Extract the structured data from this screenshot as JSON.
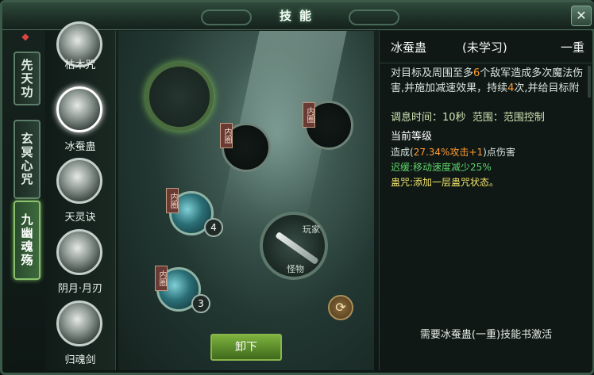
{
  "window": {
    "title": "技能",
    "close_icon": "close-icon"
  },
  "tabs": [
    {
      "label": "先天功",
      "active": false
    },
    {
      "label": "玄冥心咒",
      "active": false
    },
    {
      "label": "九幽魂殇",
      "active": true
    }
  ],
  "skills": [
    {
      "name": "枯木咒",
      "icon": "withered-tree-icon"
    },
    {
      "name": "冰蚕蛊",
      "icon": "ice-silkworm-icon",
      "selected": true
    },
    {
      "name": "天灵诀",
      "icon": "spirit-claw-icon"
    },
    {
      "name": "阴月·月刃",
      "icon": "moon-blade-icon"
    },
    {
      "name": "归魂剑",
      "icon": "soul-sword-icon"
    }
  ],
  "arena": {
    "inner_tag": "内圈",
    "slot_levels": [
      "4",
      "3"
    ],
    "weapon_labels": [
      "玩家",
      "怪物"
    ],
    "unload_button": "卸下",
    "refresh_icon": "refresh-icon"
  },
  "detail": {
    "name": "冰蚕蛊",
    "state": "(未学习)",
    "rank": "一重",
    "desc_prefix": "对目标及周围至多",
    "desc_num1": "6",
    "desc_mid": "个敌军造成多次魔法伤害,并施加减速效果，持续",
    "desc_num2": "4",
    "desc_suffix": "次,并给目标附加蛊咒效果",
    "cooldown": "调息时间：10秒",
    "range": "范围：范围控制",
    "current_level": "当前等级",
    "effect_prefix": "造成(",
    "effect_value": "27.34%攻击+1",
    "effect_suffix": ")点伤害",
    "slow_label": "迟缓:",
    "slow_text": "移动速度减少25%",
    "curse_label": "蛊咒:",
    "curse_text": "添加一层蛊咒状态。",
    "requirement": "需要冰蚕蛊(一重)技能书激活"
  },
  "colors": {
    "accent": "#7cb13d",
    "highlight": "#ff9b2f",
    "slow": "#5fd36a",
    "curse": "#f0e36a"
  }
}
